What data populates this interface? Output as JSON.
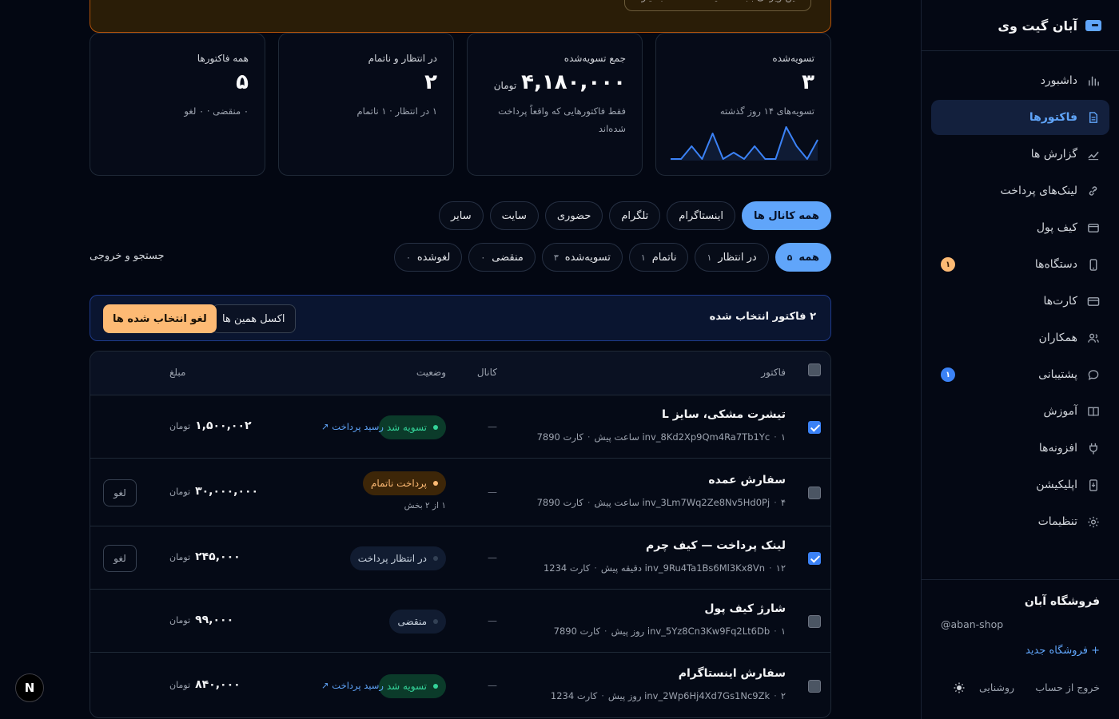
{
  "brand": {
    "name": "آبان گیت وی",
    "logo_icon": "card-icon"
  },
  "sidebar": {
    "items": [
      {
        "label": "داشبورد",
        "icon": "chart-bars-icon",
        "active": false
      },
      {
        "label": "فاکتورها",
        "icon": "document-icon",
        "active": true
      },
      {
        "label": "گزارش ها",
        "icon": "trend-icon",
        "active": false
      },
      {
        "label": "لینک‌های پرداخت",
        "icon": "link-icon",
        "active": false
      },
      {
        "label": "کیف پول",
        "icon": "wallet-icon",
        "active": false
      },
      {
        "label": "دستگاه‌ها",
        "icon": "phone-icon",
        "active": false,
        "badge": "۱"
      },
      {
        "label": "کارت‌ها",
        "icon": "credit-card-icon",
        "active": false
      },
      {
        "label": "همکاران",
        "icon": "users-icon",
        "active": false
      },
      {
        "label": "پشتیبانی",
        "icon": "chat-icon",
        "active": false,
        "badge": "۱"
      },
      {
        "label": "آموزش",
        "icon": "book-icon",
        "active": false
      },
      {
        "label": "افزونه‌ها",
        "icon": "plug-icon",
        "active": false
      },
      {
        "label": "اپلیکیشن",
        "icon": "download-icon",
        "active": false
      },
      {
        "label": "تنظیمات",
        "icon": "gear-icon",
        "active": false
      }
    ],
    "store": {
      "name": "فروشگاه آبان",
      "handle": "@aban-shop",
      "new_store": "+ فروشگاه جدید"
    },
    "logout": "خروج از حساب",
    "theme": "روشنایی"
  },
  "banner": {
    "text": "این ویژگی بابت که نیست — فعلاً بسیار"
  },
  "stats": [
    {
      "label": "همه فاکتورها",
      "value": "۵",
      "unit": "",
      "sub": "۰ منقضی · ۰ لغو"
    },
    {
      "label": "در انتظار و ناتمام",
      "value": "۲",
      "unit": "",
      "sub": "۱ در انتظار · ۱ ناتمام"
    },
    {
      "label": "جمع تسویه‌شده",
      "value": "۴,۱۸۰,۰۰۰",
      "unit": "تومان",
      "sub": "فقط فاکتورهایی که واقعاً پرداخت شده‌اند"
    },
    {
      "label": "تسویه‌شده",
      "value": "۳",
      "unit": "",
      "sub": "تسویه‌های ۱۴ روز گذشته"
    }
  ],
  "sparkline": [
    0,
    0,
    2,
    0,
    4,
    0,
    1,
    0,
    2,
    0,
    0,
    5,
    2,
    0,
    3
  ],
  "channels": [
    {
      "label": "همه کانال ها",
      "active": true
    },
    {
      "label": "اینستاگرام",
      "active": false
    },
    {
      "label": "تلگرام",
      "active": false
    },
    {
      "label": "حضوری",
      "active": false
    },
    {
      "label": "سایت",
      "active": false
    },
    {
      "label": "سایر",
      "active": false
    }
  ],
  "status_filters": [
    {
      "label": "همه",
      "count": "۵",
      "active": true
    },
    {
      "label": "در انتظار",
      "count": "۱",
      "active": false
    },
    {
      "label": "ناتمام",
      "count": "۱",
      "active": false
    },
    {
      "label": "تسویه‌شده",
      "count": "۳",
      "active": false
    },
    {
      "label": "منقضی",
      "count": "۰",
      "active": false
    },
    {
      "label": "لغوشده",
      "count": "۰",
      "active": false
    }
  ],
  "search_export": "جستجو و خروجی",
  "selection": {
    "text": "۲ فاکتور انتخاب شده",
    "excel": "اکسل همین ها",
    "cancel_selected": "لغو انتخاب شده ها"
  },
  "table": {
    "headers": {
      "invoice": "فاکتور",
      "channel": "کانال",
      "status": "وضعیت",
      "amount": "مبلغ"
    },
    "rows": [
      {
        "title": "تیشرت مشکی، سایز L",
        "id": "inv_8Kd2Xp9Qm4Ra7Tb1Yc",
        "time": "۱ ساعت پیش",
        "card": "کارت 7890",
        "channel": "—",
        "status": "تسویه شد",
        "status_kind": "settled",
        "receipt": "رسید پرداخت ↗",
        "amount": "۱,۵۰۰,۰۰۲",
        "unit": "تومان",
        "checked": true
      },
      {
        "title": "سفارش عمده",
        "id": "inv_3Lm7Wq2Ze8Nv5Hd0Pj",
        "time": "۴ ساعت پیش",
        "card": "کارت 7890",
        "channel": "—",
        "status": "پرداخت ناتمام",
        "status_kind": "partial",
        "partial_sub": "۱ از ۲ بخش",
        "amount": "۳۰,۰۰۰,۰۰۰",
        "unit": "تومان",
        "void": "لغو",
        "checked": false
      },
      {
        "title": "لینک پرداخت — کیف چرم",
        "id": "inv_9Ru4Ta1Bs6Ml3Kx8Vn",
        "time": "۱۲ دقیقه پیش",
        "card": "کارت 1234",
        "channel": "—",
        "status": "در انتظار پرداخت",
        "status_kind": "pending",
        "amount": "۲۴۵,۰۰۰",
        "unit": "تومان",
        "void": "لغو",
        "checked": true
      },
      {
        "title": "شارژ کیف پول",
        "id": "inv_5Yz8Cn3Kw9Fq2Lt6Db",
        "time": "۱ روز پیش",
        "card": "کارت 7890",
        "channel": "—",
        "status": "منقضی",
        "status_kind": "expired",
        "amount": "۹۹,۰۰۰",
        "unit": "تومان",
        "checked": false
      },
      {
        "title": "سفارش اینستاگرام",
        "id": "inv_2Wp6Hj4Xd7Gs1Nc9Zk",
        "time": "۲ روز پیش",
        "card": "کارت 1234",
        "channel": "—",
        "status": "تسویه شد",
        "status_kind": "settled",
        "receipt": "رسید پرداخت ↗",
        "amount": "۸۴۰,۰۰۰",
        "unit": "تومان",
        "checked": false
      }
    ]
  },
  "next_badge": "N"
}
